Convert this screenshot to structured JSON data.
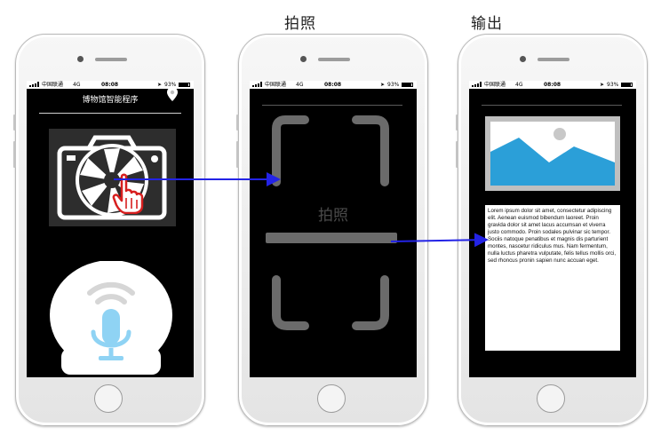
{
  "labels": {
    "capture": "拍照",
    "output": "输出"
  },
  "status_bar": {
    "carrier": "中国联通",
    "network": "4G",
    "time": "08:08",
    "battery": "93%"
  },
  "phone1": {
    "app_title": "博物馆智能程序"
  },
  "phone2": {
    "viewfinder_text": "拍照"
  },
  "phone3": {
    "body_text": "Lorem ipsum dolor sit amet, consectetur adipiscing elit. Aenean euismod bibendum laoreet. Proin gravida dolor sit amet lacus accumsan et viverra justo commodo. Proin sodales pulvinar sic tempor. Sociis natoque penatibus et magnis dis parturient montes, nascetur ridiculus mus. Nam fermentum, nulla luctus pharetra vulputate, felis tellus mollis orci, sed rhoncus pronin sapien nunc accuan eget."
  },
  "colors": {
    "arrow": "#2323e6",
    "image_sky": "#ffffff",
    "image_hills": "#2b9fd8",
    "mic": "#8fd3f4",
    "finger": "#d71f1f"
  },
  "icons": [
    "camera-icon",
    "pointing-hand-icon",
    "microphone-icon",
    "pin-icon",
    "image-placeholder-icon"
  ]
}
